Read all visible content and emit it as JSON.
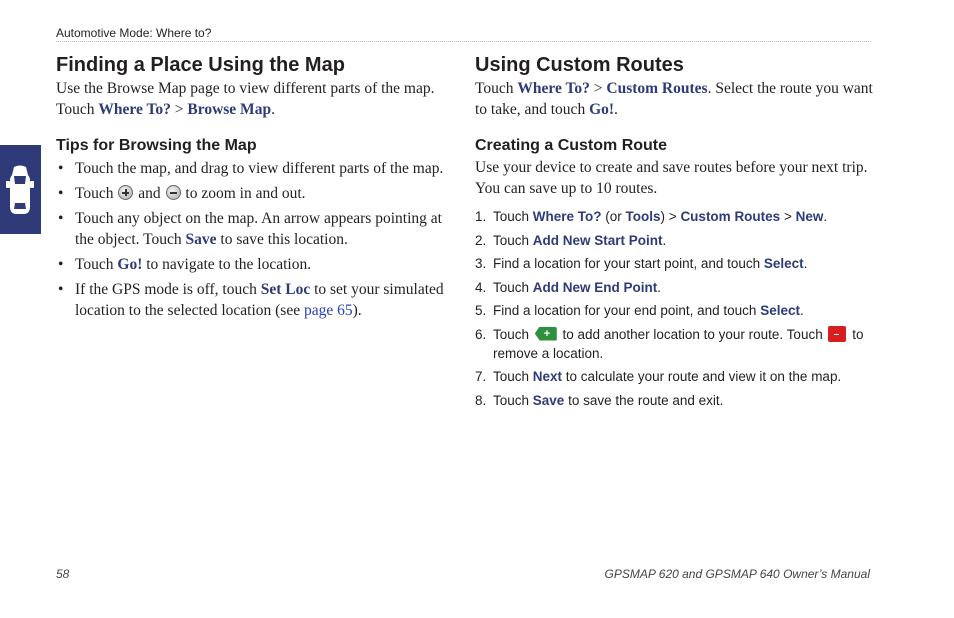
{
  "header": {
    "running_title": "Automotive Mode: Where to?"
  },
  "left": {
    "title": "Finding a Place Using the Map",
    "intro": {
      "text1": "Use the Browse Map page to view different parts of the map. Touch ",
      "where_to": "Where To?",
      "sep": " > ",
      "browse_map": "Browse Map",
      "end": "."
    },
    "tips_heading": "Tips for Browsing the Map",
    "tips": {
      "t1": "Touch the map, and drag to view different parts of the map.",
      "t2_a": "Touch ",
      "t2_b": " and ",
      "t2_c": " to zoom in and out.",
      "t3_a": "Touch any object on the map. An arrow appears pointing at the object. Touch ",
      "t3_save": "Save",
      "t3_b": " to save this location.",
      "t4_a": "Touch ",
      "t4_go": "Go!",
      "t4_b": " to navigate to the location.",
      "t5_a": "If the GPS mode is off, touch ",
      "t5_setloc": "Set Loc",
      "t5_b": " to set your simulated location to the selected location (see ",
      "t5_link": "page 65",
      "t5_c": ")."
    }
  },
  "right": {
    "title": "Using Custom Routes",
    "intro": {
      "a": "Touch ",
      "where_to": "Where To?",
      "sep": " > ",
      "custom_routes": "Custom Routes",
      "b": ". Select the route you want to take, and touch ",
      "go": "Go!",
      "c": "."
    },
    "create_heading": "Creating a Custom Route",
    "create_intro": "Use your device to create and save routes before your next trip. You can save up to 10 routes.",
    "steps": {
      "n1": "1.",
      "n2": "2.",
      "n3": "3.",
      "n4": "4.",
      "n5": "5.",
      "n6": "6.",
      "n7": "7.",
      "n8": "8.",
      "s1_a": "Touch ",
      "s1_where": "Where To?",
      "s1_b": " (or ",
      "s1_tools": "Tools",
      "s1_c": ") > ",
      "s1_custom": "Custom Routes",
      "s1_d": " > ",
      "s1_new": "New",
      "s1_e": ".",
      "s2_a": "Touch ",
      "s2_b": "Add New Start Point",
      "s2_c": ".",
      "s3_a": "Find a location for your start point, and touch ",
      "s3_b": "Select",
      "s3_c": ".",
      "s4_a": "Touch ",
      "s4_b": "Add New End Point",
      "s4_c": ".",
      "s5_a": "Find a location for your end point, and touch ",
      "s5_b": "Select",
      "s5_c": ".",
      "s6_a": "Touch ",
      "s6_b": " to add another location to your route. Touch ",
      "s6_c": " to remove a location.",
      "s7_a": "Touch ",
      "s7_b": "Next",
      "s7_c": " to calculate your route and view it on the map.",
      "s8_a": "Touch ",
      "s8_b": "Save",
      "s8_c": " to save the route and exit."
    }
  },
  "footer": {
    "page_number": "58",
    "manual_title": "GPSMAP 620 and GPSMAP 640 Owner’s Manual"
  },
  "colors": {
    "accent": "#2e3b78",
    "link": "#2b3fb8",
    "add_icon": "#2e8f3c",
    "remove_icon": "#d81f1f"
  },
  "icons": [
    "car-icon",
    "zoom-in-icon",
    "zoom-out-icon",
    "add-point-icon",
    "remove-point-icon"
  ]
}
